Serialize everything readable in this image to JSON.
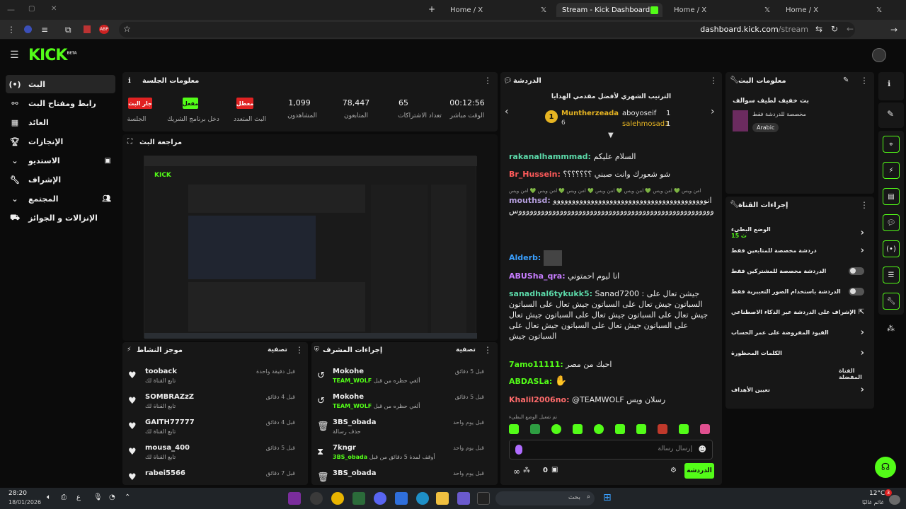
{
  "browser": {
    "tabs": [
      {
        "label": "Home / X"
      },
      {
        "label": "Stream - Kick Dashboard"
      },
      {
        "label": "Home / X"
      },
      {
        "label": "Home / X"
      }
    ],
    "url_domain": "dashboard.kick.com",
    "url_path": "/stream"
  },
  "kick": {
    "logo": "KICK",
    "beta": "BETA"
  },
  "sidebar": {
    "items": [
      {
        "label": "البث",
        "icon": "live-icon"
      },
      {
        "label": "رابط ومفتاح البث",
        "icon": "link-icon"
      },
      {
        "label": "العائد",
        "icon": "revenue-icon"
      },
      {
        "label": "الإنجازات",
        "icon": "trophy-icon"
      },
      {
        "label": "الاستديو",
        "icon": "studio-icon"
      },
      {
        "label": "الإشراف",
        "icon": "wrench-icon"
      },
      {
        "label": "المجتمع",
        "icon": "community-icon"
      },
      {
        "label": "الإنزالات و الجوائز",
        "icon": "drops-icon"
      }
    ]
  },
  "session": {
    "title": "معلومات الجلسة",
    "stats": [
      {
        "value": "00:12:56",
        "label": "الوقت مباشر"
      },
      {
        "value": "65",
        "label": "تعداد الاشتراكات"
      },
      {
        "value": "78,447",
        "label": "المتابعون"
      },
      {
        "value": "1,099",
        "label": "المشاهدون"
      }
    ],
    "badges": [
      {
        "value": "معطل",
        "label": "البث المتعدد"
      },
      {
        "value": "مفعل",
        "label": "دخل برنامج الشريك"
      },
      {
        "value": "جار البث",
        "label": "الجلسة"
      }
    ]
  },
  "preview": {
    "title": "مراجعة البث"
  },
  "activity": {
    "title": "موجز النشاط",
    "filter": "تصفية",
    "rows": [
      {
        "name": "tooback",
        "sub": "تابع القناة لك",
        "time": "قبل دقيقة واحدة"
      },
      {
        "name": "SOMBRAZzZ",
        "sub": "تابع القناة لك",
        "time": "قبل 4 دقائق"
      },
      {
        "name": "GAITH77777",
        "sub": "تابع القناة لك",
        "time": "قبل 4 دقائق"
      },
      {
        "name": "mousa_400",
        "sub": "تابع القناة لك",
        "time": "قبل 5 دقائق"
      },
      {
        "name": "rabei5566",
        "sub": "",
        "time": "قبل 7 دقائق"
      }
    ]
  },
  "mod_actions": {
    "title": "إجراءات المشرف",
    "filter": "تصفية",
    "rows": [
      {
        "name": "Mokohe",
        "sub": "ألغي حظره من قبل",
        "by": "TEAM_WOLF",
        "time": "قبل 5 دقائق",
        "icon": "undo-icon"
      },
      {
        "name": "Mokohe",
        "sub": "ألغي حظره من قبل",
        "by": "TEAM_WOLF",
        "time": "قبل 5 دقائق",
        "icon": "undo-icon"
      },
      {
        "name": "3BS_obada",
        "sub": "حذف رسالة",
        "by": "",
        "time": "قبل يوم واحد",
        "icon": "trash-icon"
      },
      {
        "name": "7kngr",
        "sub": "أوقف لمدة 5 دقائق من قبل",
        "by": "3BS_obada",
        "time": "قبل يوم واحد",
        "icon": "hourglass-icon"
      },
      {
        "name": "3BS_obada",
        "sub": "",
        "by": "",
        "time": "قبل يوم واحد",
        "icon": "trash-icon"
      }
    ]
  },
  "chat": {
    "title": "الدردشة",
    "leaderboard_title": "الترتيب الشهري لأفضل مقدمي الهدايا",
    "top1_name": "Muntherzeada",
    "top1_count": "6",
    "top2_name": "aboyoseif",
    "top2_count": "1",
    "top3_name": "salehmosad1",
    "top3_count": "1",
    "messages": [
      {
        "user": "rakanalhammmad:",
        "color": "#5bd8a8",
        "text": "السلام عليكم"
      },
      {
        "user": "Br_Hussein:",
        "color": "#ff5a5a",
        "text": "شو شعورك وانت صبني ؟؟؟؟؟؟؟"
      },
      {
        "user": "",
        "color": "#aaa",
        "text": "امن ويس 💚 امن ويس 💚 امن ويس 💚 امن ويس 💚 امن ويس 💚 امن ويس 💚 امن ويس"
      },
      {
        "user": "mouthsd:",
        "color": "#b39ddb",
        "text": "انوووووووووووووووووووووووووووووووووووووووووووووووووووووووووووووووووووووووووووووووووووووووووووووس"
      },
      {
        "user": "Alderb:",
        "color": "#3aa0ff",
        "text": ""
      },
      {
        "user": "ABUSha_qra:",
        "color": "#c77dff",
        "text": "انا ليوم احمتوني"
      },
      {
        "user": "sanadhal6tykukk5:",
        "color": "#5bd8a8",
        "text": "Sanad7200 : جيشن تعال على السباتون جيش تعال على السباتون جيش تعال على السباتون جيش تعال على السباتون جيش تعال على السباتون جيش تعال على السباتون جيش تعال على السباتون جيش تعال على السباتون جيش"
      },
      {
        "user": "7amo11111:",
        "color": "#53fc18",
        "text": "احبك من مصر"
      },
      {
        "user": "ABDASLa:",
        "color": "#53fc18",
        "text": ""
      },
      {
        "user": "Khalil2006no:",
        "color": "#ff6b6b",
        "text": "@TEAMWOLF رسلان ويس"
      }
    ],
    "emote_notice": "تم تفعيل الوضع البطيء",
    "input_placeholder": "إرسال رسالة",
    "send_label": "الدردشة",
    "points": "0"
  },
  "stream_info": {
    "title": "معلومات البث",
    "stream_title": "بث خفيف لطيف سوالف",
    "subtitle": "مخصصة للدردشة فقط",
    "language": "Arabic"
  },
  "channel_actions": {
    "title": "إجراءات القناة",
    "items": [
      {
        "label": "الوضع البطيء",
        "sub": "15 ث",
        "control": "chevron"
      },
      {
        "label": "دردشة مخصصة للمتابعين فقط",
        "control": "chevron"
      },
      {
        "label": "الدردشة مخصصة للمشتركين فقط",
        "control": "toggle"
      },
      {
        "label": "الدردشة باستخدام الصور التعبيرية فقط",
        "control": "toggle"
      },
      {
        "label": "الإشراف على الدردشة عبر الذكاء الاصطناعي",
        "control": "external"
      },
      {
        "label": "القيود المفروضة على عمر الحساب",
        "control": "chevron"
      },
      {
        "label": "الكلمات المحظورة",
        "control": "chevron"
      }
    ],
    "section2": "القناة المفضلة",
    "goals": "تعيين الأهداف"
  },
  "taskbar": {
    "time": "28:20",
    "date": "18/01/2026",
    "lang": "ع",
    "search_placeholder": "بحث",
    "weather_temp": "12°C",
    "weather_label": "غائم غالبًا",
    "notif_count": "3"
  }
}
